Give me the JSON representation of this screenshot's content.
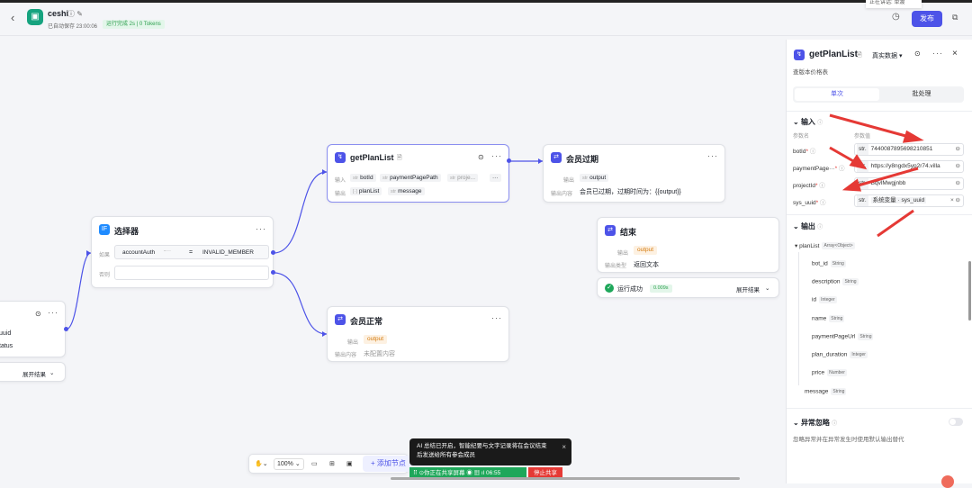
{
  "header": {
    "back_glyph": "‹",
    "app_name": "ceshi",
    "autosave": "已自动保存 23:00:06",
    "run_status": "运行完成 2s | 0 Tokens",
    "tooltip": "正在讲话: 单渡",
    "publish_label": "发布"
  },
  "canvas": {
    "nodes": {
      "partial": {
        "field1": "uuid",
        "field2": "tatus",
        "expand": "展开结果"
      },
      "selector": {
        "title": "选择器",
        "if_label": "如果",
        "condition_var": "accountAuth",
        "condition_op": "=",
        "condition_value": "INVALID_MEMBER",
        "else_label": "否则"
      },
      "getplanlist": {
        "title": "getPlanList",
        "input_label": "输入",
        "inputs": [
          "botId",
          "paymentPagePath",
          "proje..."
        ],
        "output_label": "输出",
        "outputs": [
          "planList",
          "message"
        ]
      },
      "expired": {
        "title": "会员过期",
        "output_label": "输出",
        "output_var": "output",
        "content_label": "输出内容",
        "content": "会员已过期，过期时间为：{{output}}"
      },
      "end": {
        "title": "结束",
        "output_label": "输出",
        "output_var": "output",
        "type_label": "输出类型",
        "type_value": "返回文本"
      },
      "run_result": {
        "label": "运行成功",
        "badge": "0.009s",
        "expand": "展开结果"
      },
      "normal": {
        "title": "会员正常",
        "output_label": "输出",
        "output_var": "output",
        "content_label": "输出内容",
        "content": "未配置内容"
      }
    },
    "toolbar": {
      "zoom": "100%",
      "add_node": "添加节点"
    },
    "toast": {
      "line1": "AI 总结已开启，智能纪要与文字记录将在会议结束",
      "line2": "后发送给所有参会成员"
    },
    "share": {
      "label": "你正在共享屏幕",
      "time": "06:55",
      "stop": "停止共享"
    }
  },
  "panel": {
    "title": "getPlanList",
    "mode": "真实数据",
    "subtitle": "查版本价格表",
    "tabs": [
      "单次",
      "批处理"
    ],
    "input_section": "输入",
    "col_name": "参数名",
    "col_value": "参数值",
    "params": [
      {
        "name": "botId",
        "req": "*",
        "type": "str.",
        "value": "7440087895698210851"
      },
      {
        "name": "paymentPage···",
        "req": "*",
        "type": "str.",
        "value": "https://y8ngdx5yp2r74.villa"
      },
      {
        "name": "projectId",
        "req": "*",
        "type": "str.",
        "value": "BqvlMwgjnbb"
      },
      {
        "name": "sys_uuid",
        "req": "*",
        "type": "str.",
        "value": "系统变量 · sys_uuid"
      }
    ],
    "output_section": "输出",
    "outputs": [
      {
        "name": "planList",
        "type": "Array<Object>"
      },
      {
        "name": "bot_id",
        "type": "String"
      },
      {
        "name": "description",
        "type": "String"
      },
      {
        "name": "id",
        "type": "Integer"
      },
      {
        "name": "name",
        "type": "String"
      },
      {
        "name": "paymentPageUrl",
        "type": "String"
      },
      {
        "name": "plan_duration",
        "type": "Integer"
      },
      {
        "name": "price",
        "type": "Number"
      },
      {
        "name": "message",
        "type": "String"
      }
    ],
    "exception_section": "异常忽略",
    "exception_desc": "忽略异常并在异常发生时使用默认输出替代"
  },
  "colors": {
    "accent": "#4d53e8",
    "success": "#1ea75a",
    "danger": "#e53935",
    "annotation_arrow": "#e53935"
  }
}
